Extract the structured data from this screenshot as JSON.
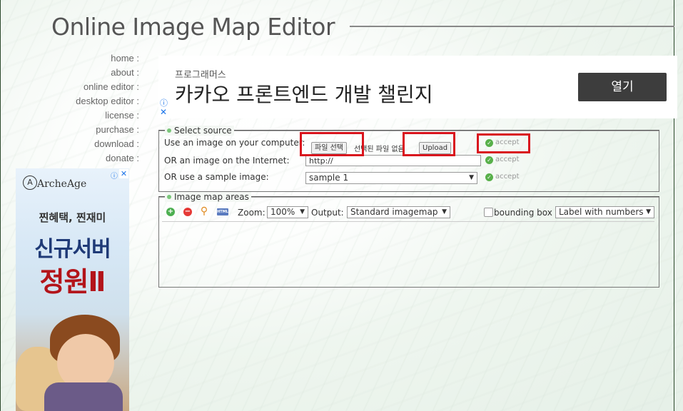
{
  "page": {
    "title": "Online Image Map Editor"
  },
  "nav": {
    "items": [
      "home :",
      "about :",
      "online editor :",
      "desktop editor :",
      "license :",
      "purchase :",
      "download :",
      "donate :"
    ]
  },
  "ad_top": {
    "sub": "프로그래머스",
    "main": "카카오 프론트엔드 개발 챌린지",
    "button": "열기",
    "info": "ⓘ",
    "close": "✕"
  },
  "ad_side": {
    "brand": "ArcheAge",
    "line1": "찐혜택, 찐재미",
    "line2": "신규서버",
    "line3": "정원Ⅱ",
    "info": "ⓘ",
    "close": "✕"
  },
  "select_source": {
    "legend": "Select source",
    "rows": [
      {
        "label": "Use an image on your computer:"
      },
      {
        "label": "OR an image on the Internet:"
      },
      {
        "label": "OR use a sample image:"
      }
    ],
    "file_button": "파일 선택",
    "file_status": "선택된 파일 없음",
    "upload_button": "Upload",
    "url_value": "http://",
    "sample_value": "sample 1",
    "accept": "accept"
  },
  "image_map_areas": {
    "legend": "Image map areas",
    "zoom_label": "Zoom:",
    "zoom_value": "100%",
    "output_label": "Output:",
    "output_value": "Standard imagemap",
    "bounding_box_label": "bounding box",
    "label_mode": "Label with numbers",
    "html_icon": "HTML"
  },
  "colors": {
    "highlight": "#d9141d",
    "accept_green": "#58b04a"
  }
}
